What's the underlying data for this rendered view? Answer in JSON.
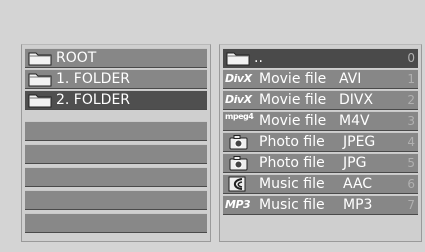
{
  "left_panel": {
    "items": [
      {
        "label": "ROOT",
        "icon": "folder-icon"
      },
      {
        "label": "1. FOLDER",
        "icon": "folder-icon"
      },
      {
        "label": "2. FOLDER",
        "icon": "folder-icon"
      },
      {
        "label": ""
      },
      {
        "label": ""
      },
      {
        "label": ""
      },
      {
        "label": ""
      },
      {
        "label": ""
      }
    ]
  },
  "right_panel": {
    "items": [
      {
        "type": "..",
        "ext": "",
        "index": "0",
        "icon": "folder-up-icon"
      },
      {
        "type": "Movie file",
        "ext": "AVI",
        "index": "1",
        "icon": "divx-icon",
        "badge": "DivX"
      },
      {
        "type": "Movie file",
        "ext": "DIVX",
        "index": "2",
        "icon": "divx-icon",
        "badge": "DivX"
      },
      {
        "type": "Movie file",
        "ext": "M4V",
        "index": "3",
        "icon": "mpeg4-icon",
        "badge": "mpeg4"
      },
      {
        "type": "Photo file",
        "ext": "JPEG",
        "index": "4",
        "icon": "camera-icon"
      },
      {
        "type": "Photo file",
        "ext": "JPG",
        "index": "5",
        "icon": "camera-icon"
      },
      {
        "type": "Music file",
        "ext": "AAC",
        "index": "6",
        "icon": "music-wave-icon"
      },
      {
        "type": "Music file",
        "ext": "MP3",
        "index": "7",
        "icon": "mp3-icon",
        "badge": "MP3"
      }
    ]
  }
}
